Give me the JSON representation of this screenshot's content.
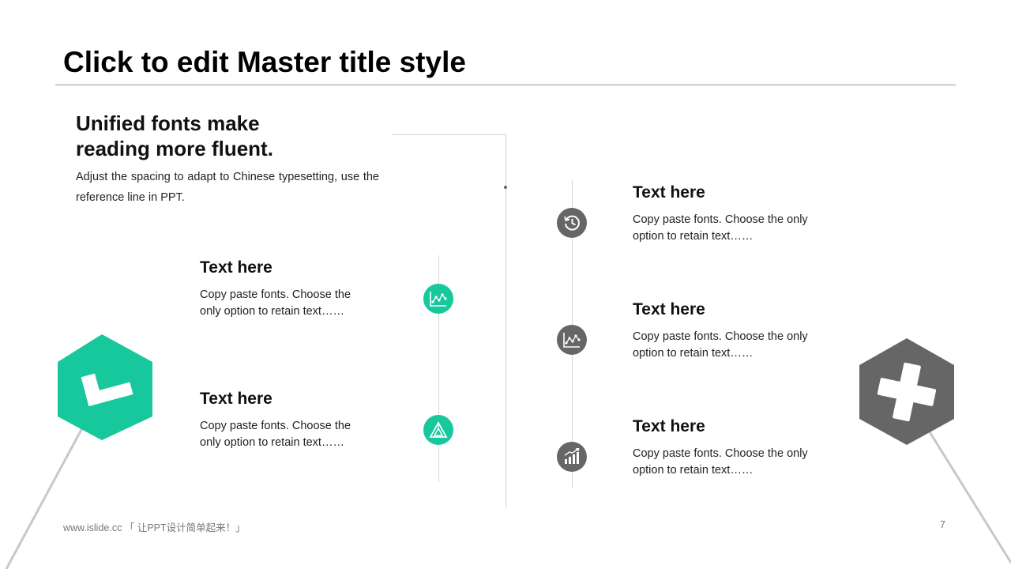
{
  "slide": {
    "title": "Click to edit Master title style",
    "intro_heading_line1": "Unified fonts make",
    "intro_heading_line2": "reading more fluent.",
    "intro_body": "Adjust the spacing to adapt to Chinese typesetting, use the reference line in PPT."
  },
  "left_items": [
    {
      "heading": "Text here",
      "body": "Copy paste fonts. Choose the only option to retain text……",
      "icon": "chart-scatter-icon",
      "color": "#16c89b"
    },
    {
      "heading": "Text here",
      "body": "Copy paste fonts. Choose the only option to retain text……",
      "icon": "triangle-icon",
      "color": "#16c89b"
    }
  ],
  "right_items": [
    {
      "heading": "Text here",
      "body": "Copy paste fonts. Choose the only option to retain text……",
      "icon": "history-clock-icon",
      "color": "#666666"
    },
    {
      "heading": "Text here",
      "body": "Copy paste fonts. Choose the only option to retain text……",
      "icon": "chart-scatter-icon",
      "color": "#666666"
    },
    {
      "heading": "Text here",
      "body": "Copy paste fonts. Choose the only option to retain text……",
      "icon": "bar-chart-growth-icon",
      "color": "#666666"
    }
  ],
  "badges": {
    "left": {
      "icon": "checkmark-icon",
      "color": "#16c89b"
    },
    "right": {
      "icon": "cross-icon",
      "color": "#666666"
    }
  },
  "footer": {
    "left": "www.islide.cc 「 让PPT设计简单起来！」",
    "page_number": "7"
  }
}
